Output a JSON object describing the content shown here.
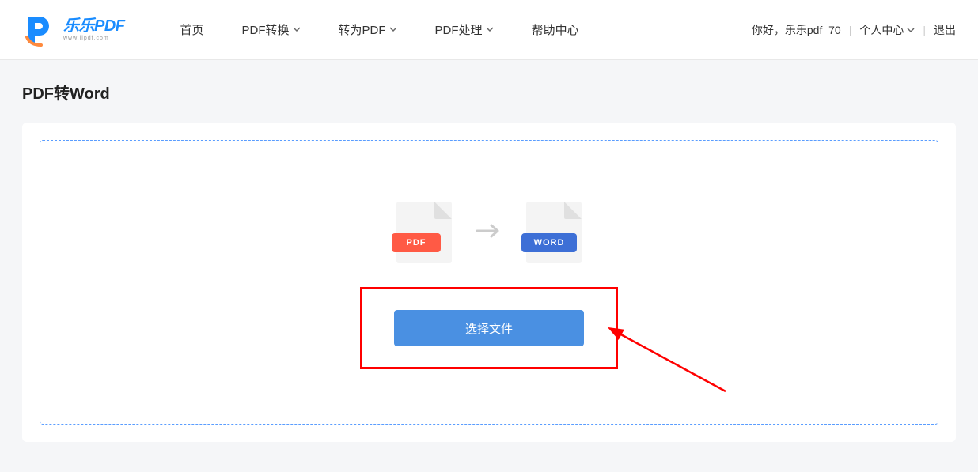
{
  "logo": {
    "brand_cn": "乐乐",
    "brand_en": "PDF",
    "url": "www.llpdf.com"
  },
  "nav": {
    "home": "首页",
    "pdf_convert": "PDF转换",
    "to_pdf": "转为PDF",
    "pdf_process": "PDF处理",
    "help": "帮助中心"
  },
  "user": {
    "greeting": "你好，乐乐pdf_70",
    "center": "个人中心",
    "logout": "退出"
  },
  "page": {
    "title": "PDF转Word"
  },
  "graphic": {
    "pdf_label": "PDF",
    "word_label": "WORD"
  },
  "action": {
    "choose_file": "选择文件"
  }
}
